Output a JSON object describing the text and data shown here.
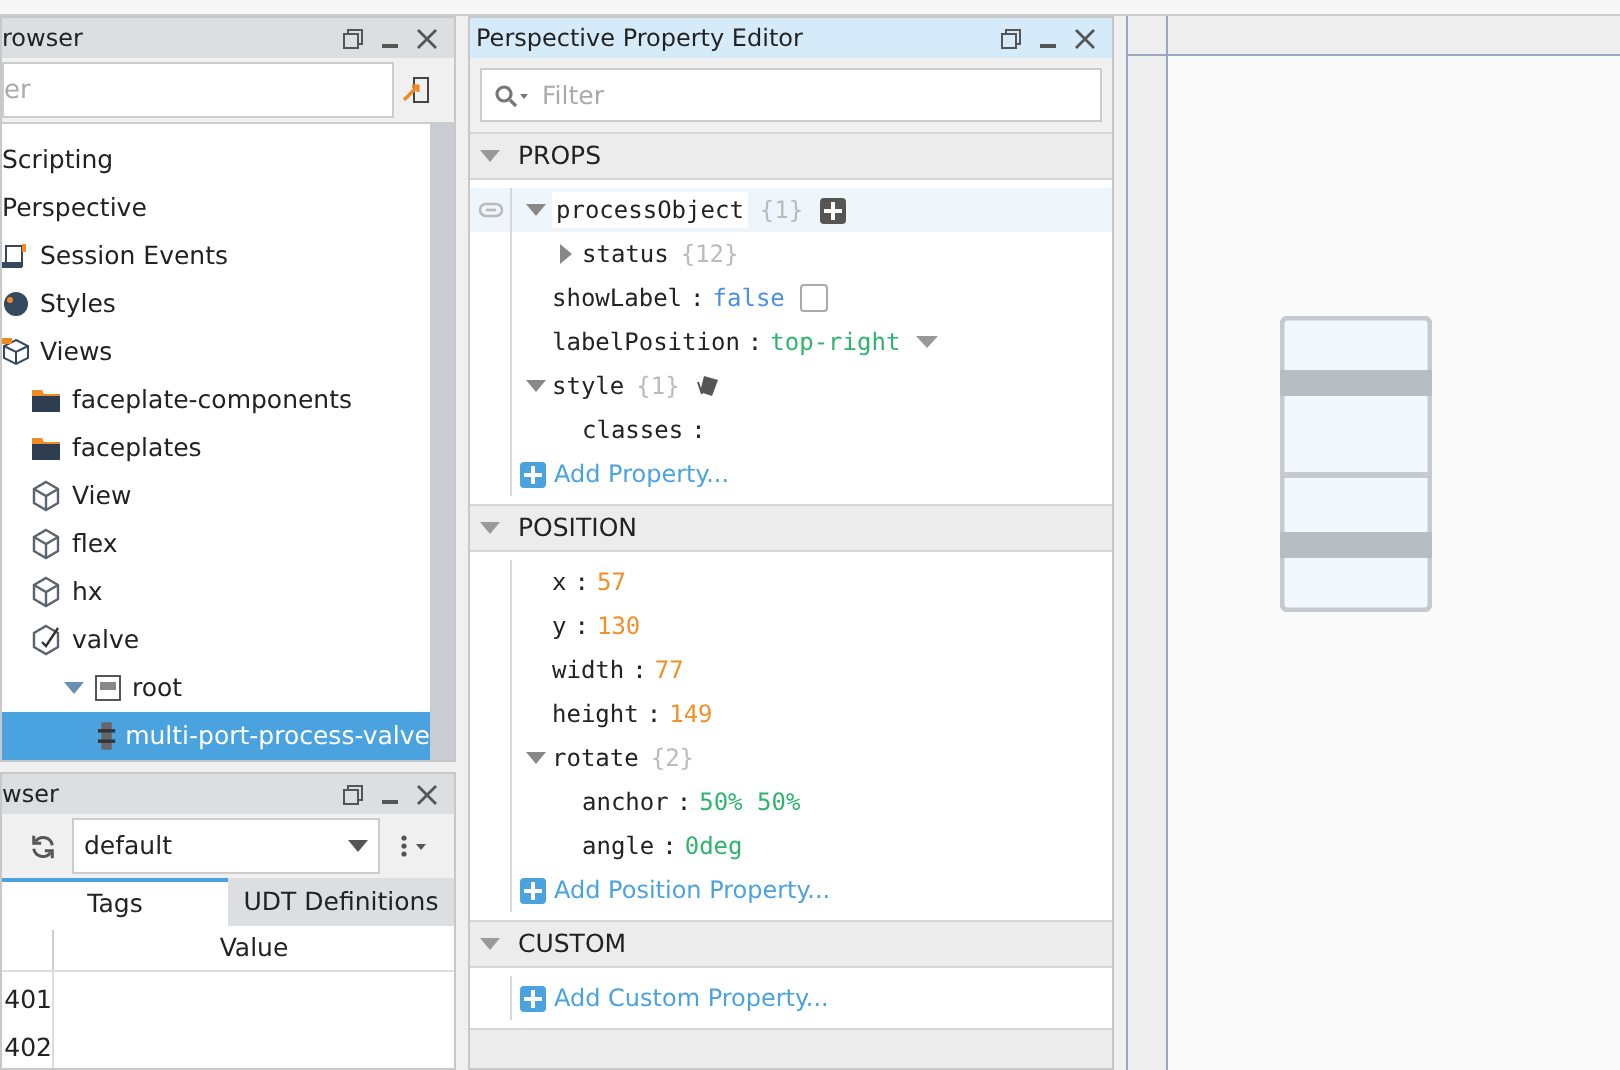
{
  "project_browser": {
    "title": "rowser",
    "filter": {
      "placeholder": "er"
    },
    "tree": [
      {
        "label": "Scripting",
        "selected": false
      },
      {
        "label": "Perspective",
        "selected": false,
        "children": [
          {
            "label": "Session Events",
            "kind": "events",
            "selected": false
          },
          {
            "label": "Styles",
            "kind": "styles",
            "selected": false
          },
          {
            "label": "Views",
            "kind": "views",
            "selected": false,
            "children": [
              {
                "label": "faceplate-components",
                "kind": "folder",
                "selected": false
              },
              {
                "label": "faceplates",
                "kind": "folder",
                "selected": false
              },
              {
                "label": "View",
                "kind": "view",
                "selected": false
              },
              {
                "label": "flex",
                "kind": "view",
                "selected": false
              },
              {
                "label": "hx",
                "kind": "view",
                "selected": false
              },
              {
                "label": "valve",
                "kind": "view-edit",
                "selected": false,
                "children": [
                  {
                    "label": "root",
                    "kind": "container",
                    "selected": false,
                    "expanded": true,
                    "children": [
                      {
                        "label": "multi-port-process-valve",
                        "kind": "component",
                        "selected": true
                      }
                    ]
                  }
                ]
              }
            ]
          }
        ]
      }
    ]
  },
  "tag_browser": {
    "title": "wser",
    "provider": "default",
    "tabs": [
      {
        "label": "Tags",
        "selected": true
      },
      {
        "label": "UDT Definitions",
        "selected": false
      }
    ],
    "columns": [
      "Value"
    ],
    "rows": [
      {
        "name": "401",
        "value": ""
      },
      {
        "name": "402",
        "value": ""
      }
    ]
  },
  "property_editor": {
    "title": "Perspective Property Editor",
    "filter": {
      "placeholder": "Filter"
    },
    "sections": [
      {
        "title": "PROPS",
        "expanded": true,
        "rows": [
          {
            "kind": "object",
            "name": "processObject",
            "count": "{1}",
            "expanded": true,
            "highlighted": true,
            "children": [
              {
                "kind": "object",
                "name": "status",
                "count": "{12}",
                "expanded": false
              }
            ]
          },
          {
            "kind": "boolean",
            "name": "showLabel",
            "separator": ":",
            "value": "false",
            "checked": false
          },
          {
            "kind": "enum",
            "name": "labelPosition",
            "separator": ":",
            "value": "top-right"
          },
          {
            "kind": "object",
            "name": "style",
            "count": "{1}",
            "expanded": true,
            "style_icon": true,
            "children": [
              {
                "kind": "string",
                "name": "classes",
                "separator": ":"
              }
            ]
          },
          {
            "kind": "add",
            "label": "Add Property..."
          }
        ]
      },
      {
        "title": "POSITION",
        "expanded": true,
        "rows": [
          {
            "kind": "number",
            "name": "x",
            "separator": ":",
            "value": "57"
          },
          {
            "kind": "number",
            "name": "y",
            "separator": ":",
            "value": "130"
          },
          {
            "kind": "number",
            "name": "width",
            "separator": ":",
            "value": "77"
          },
          {
            "kind": "number",
            "name": "height",
            "separator": ":",
            "value": "149"
          },
          {
            "kind": "object",
            "name": "rotate",
            "count": "{2}",
            "expanded": true,
            "children": [
              {
                "kind": "string",
                "name": "anchor",
                "separator": ":",
                "value": "50% 50%"
              },
              {
                "kind": "string",
                "name": "angle",
                "separator": ":",
                "value": "0deg"
              }
            ]
          },
          {
            "kind": "add",
            "label": "Add Position Property..."
          }
        ]
      },
      {
        "title": "CUSTOM",
        "expanded": true,
        "rows": [
          {
            "kind": "add",
            "label": "Add Custom Property..."
          }
        ]
      }
    ]
  }
}
